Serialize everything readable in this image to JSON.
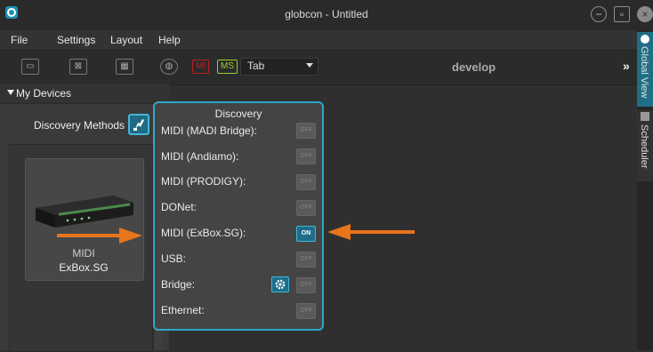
{
  "window": {
    "title": "globcon - Untitled"
  },
  "menu": {
    "items": [
      "File",
      "Settings",
      "Layout",
      "Help"
    ]
  },
  "toolbar": {
    "tab_select_value": "Tab",
    "badge_red": "MI",
    "badge_green": "MS",
    "view_label": "develop",
    "overflow_label": "»"
  },
  "right_tabs": {
    "global_view": "Global View",
    "scheduler": "Scheduler"
  },
  "left_panel": {
    "section_title": "My Devices",
    "discovery_methods_label": "Discovery Methods",
    "device": {
      "type": "MIDI",
      "name": "ExBox.SG"
    }
  },
  "popup": {
    "title": "Discovery",
    "rows": [
      {
        "label": "MIDI (MADI Bridge):",
        "state": "OFF"
      },
      {
        "label": "MIDI (Andiamo):",
        "state": "OFF"
      },
      {
        "label": "MIDI (PRODIGY):",
        "state": "OFF"
      },
      {
        "label": "DONet:",
        "state": "OFF"
      },
      {
        "label": "MIDI (ExBox.SG):",
        "state": "ON"
      },
      {
        "label": "USB:",
        "state": "OFF"
      },
      {
        "label": "Bridge:",
        "state": "OFF"
      },
      {
        "label": "Ethernet:",
        "state": "OFF"
      }
    ]
  },
  "colors": {
    "accent": "#2fa7c9",
    "annotation_arrow": "#e8741c",
    "badge_red": "#b32222",
    "badge_green": "#9ccc2e"
  }
}
